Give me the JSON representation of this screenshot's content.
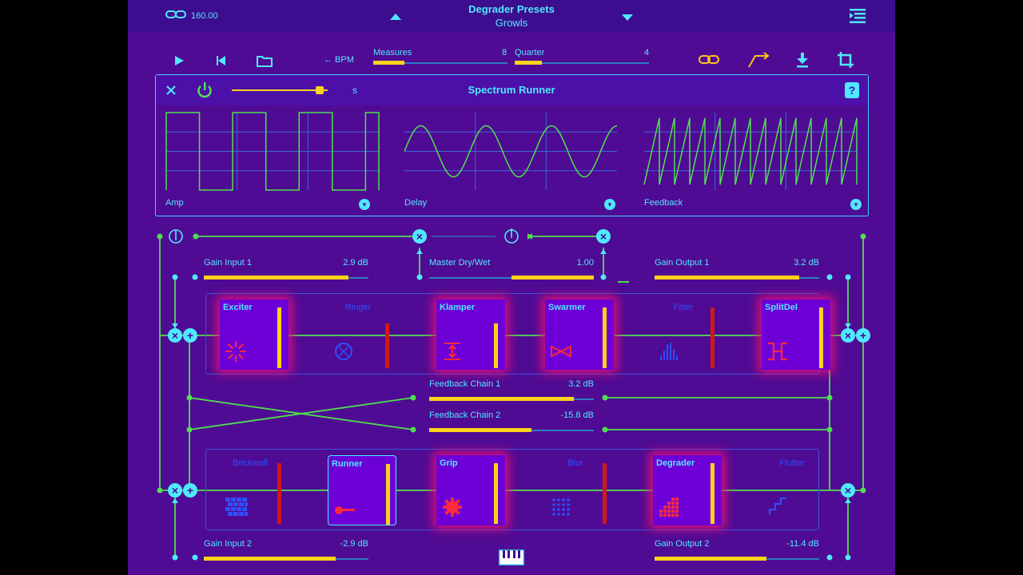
{
  "header": {
    "bpm_value": "160.00",
    "preset_title": "Degrader Presets",
    "preset_name": "Growls"
  },
  "transport": {
    "bpm_label": "← BPM",
    "measures_label": "Measures",
    "measures_value": "8",
    "measures_fill": 0.23,
    "quarter_label": "Quarter",
    "quarter_value": "4",
    "quarter_fill": 0.2
  },
  "spectrum_runner": {
    "title": "Spectrum Runner",
    "unit_label": "s",
    "slider_fill": 0.92,
    "plots": [
      {
        "label": "Amp",
        "shape": "square"
      },
      {
        "label": "Delay",
        "shape": "sine"
      },
      {
        "label": "Feedback",
        "shape": "saw"
      }
    ]
  },
  "routing": {
    "gain_input_1": {
      "label": "Gain Input 1",
      "value": "2.9 dB",
      "fill": 0.88
    },
    "master_drywet": {
      "label": "Master Dry/Wet",
      "value": "1.00",
      "fill": 0.5
    },
    "gain_output_1": {
      "label": "Gain Output 1",
      "value": "3.2 dB",
      "fill": 0.88
    },
    "feedback_chain_1": {
      "label": "Feedback Chain 1",
      "value": "3.2 dB",
      "fill": 0.88
    },
    "feedback_chain_2": {
      "label": "Feedback Chain 2",
      "value": "-15.8 dB",
      "fill": 0.62
    },
    "gain_input_2": {
      "label": "Gain Input 2",
      "value": "-2.9 dB",
      "fill": 0.8
    },
    "gain_output_2": {
      "label": "Gain Output 2",
      "value": "-11.4 dB",
      "fill": 0.68
    }
  },
  "chain1": [
    {
      "name": "Exciter",
      "active": true,
      "icon": "starburst-icon",
      "level": 0.95
    },
    {
      "name": "Ringer",
      "active": false,
      "icon": "ring-icon",
      "level": 0.7
    },
    {
      "name": "Klamper",
      "active": true,
      "icon": "clamp-icon",
      "level": 0.7
    },
    {
      "name": "Swarmer",
      "active": true,
      "icon": "bowtie-icon",
      "level": 0.95
    },
    {
      "name": "Filter",
      "active": false,
      "icon": "bars-icon",
      "level": 0.95
    },
    {
      "name": "SplitDel",
      "active": true,
      "icon": "split-icon",
      "level": 0.95
    }
  ],
  "chain2": [
    {
      "name": "Brickwall",
      "active": false,
      "icon": "bricks-icon",
      "level": 0.95
    },
    {
      "name": "Runner",
      "active": true,
      "selected": true,
      "icon": "runner-icon",
      "level": 0.95
    },
    {
      "name": "Grip",
      "active": true,
      "icon": "gear-icon",
      "level": 0.95
    },
    {
      "name": "Blur",
      "active": false,
      "icon": "dots-icon",
      "level": 0.95
    },
    {
      "name": "Degrader",
      "active": true,
      "icon": "pixels-icon",
      "level": 0.95
    },
    {
      "name": "Flutter",
      "active": false,
      "icon": "stairs-icon",
      "level": 0.0
    }
  ],
  "colors": {
    "background": "#4f0b93",
    "accent": "#4fe8ff",
    "wire": "#4fe04f",
    "fill": "#ffd21a",
    "inactive_meter": "#d01818",
    "toolbar_icon": "#ffc21a"
  }
}
